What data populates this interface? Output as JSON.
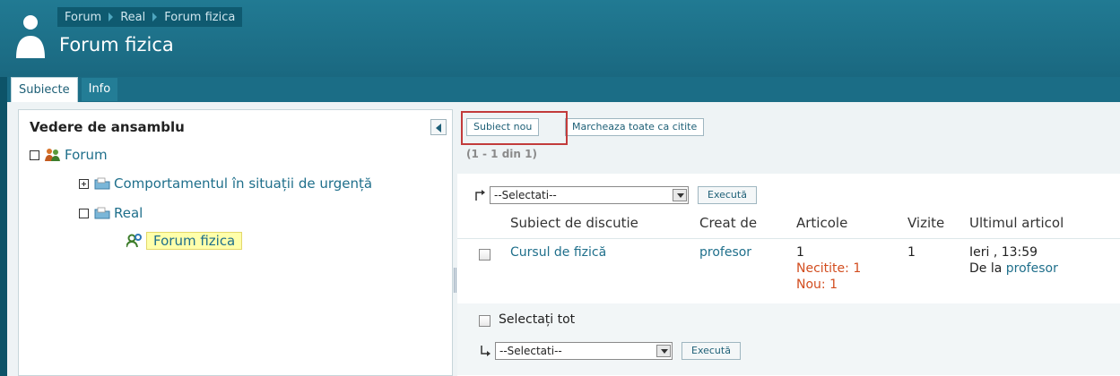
{
  "breadcrumb": [
    "Forum",
    "Real",
    "Forum fizica"
  ],
  "page_title": "Forum fizica",
  "tabs": [
    {
      "label": "Subiecte",
      "active": true
    },
    {
      "label": "Info",
      "active": false
    }
  ],
  "left_panel": {
    "title": "Vedere de ansamblu",
    "tree": {
      "root": "Forum",
      "categories": [
        "Comportamentul în situații de urgență",
        "Real"
      ],
      "selected_forum": "Forum fizica"
    }
  },
  "toolbar": {
    "new_topic": "Subiect nou",
    "mark_all_read": "Marcheaza toate ca citite"
  },
  "pagination": "(1 - 1 din 1)",
  "bulk_actions": {
    "select_placeholder": "--Selectati--",
    "execute_label": "Execută"
  },
  "table": {
    "headers": [
      "Subiect de discutie",
      "Creat de",
      "Articole",
      "Vizite",
      "Ultimul articol"
    ],
    "rows": [
      {
        "subject": "Cursul de fizică",
        "created_by": "profesor",
        "articles": "1",
        "unread": "Necitite: 1",
        "new": "Nou: 1",
        "visits": "1",
        "last_article_time": "Ieri , 13:59",
        "last_article_by_prefix": "De la",
        "last_article_by": "profesor"
      }
    ]
  },
  "select_all_label": "Selectați tot",
  "colors": {
    "header_bg": "#1b6d86",
    "link": "#1f6f8b",
    "highlight": "#ffffaa",
    "accent_red": "#c23b3b",
    "orange_text": "#d24d1f"
  }
}
